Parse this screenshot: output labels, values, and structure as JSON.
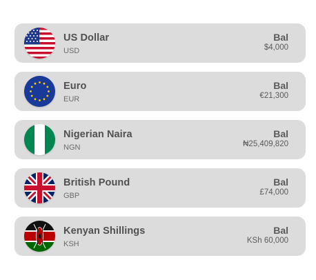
{
  "accounts": [
    {
      "name": "US Dollar",
      "code": "USD",
      "balance_label": "Bal",
      "balance": "$4,000",
      "flag_icon": "us-flag-icon"
    },
    {
      "name": "Euro",
      "code": "EUR",
      "balance_label": "Bal",
      "balance": "€21,300",
      "flag_icon": "eu-flag-icon"
    },
    {
      "name": "Nigerian Naira",
      "code": "NGN",
      "balance_label": "Bal",
      "balance": "₦25,409,820",
      "flag_icon": "nigeria-flag-icon"
    },
    {
      "name": "British Pound",
      "code": "GBP",
      "balance_label": "Bal",
      "balance": "£74,000",
      "flag_icon": "uk-flag-icon"
    },
    {
      "name": "Kenyan Shillings",
      "code": "KSH",
      "balance_label": "Bal",
      "balance": "KSh 60,000",
      "flag_icon": "kenya-flag-icon"
    }
  ],
  "colors": {
    "card_background": "#dcdcdc",
    "text_primary": "#505050",
    "text_secondary": "#6b6b6b"
  }
}
